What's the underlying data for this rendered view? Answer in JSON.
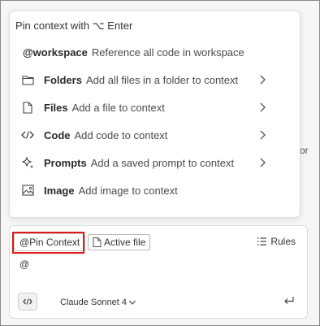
{
  "background": {
    "cut_text": "or"
  },
  "popup": {
    "header": "Pin context with ⌥ Enter",
    "items": [
      {
        "name": "@workspace",
        "desc": "Reference all code in workspace",
        "icon": "none",
        "has_submenu": false
      },
      {
        "name": "Folders",
        "desc": "Add all files in a folder to context",
        "icon": "folder-icon",
        "has_submenu": true
      },
      {
        "name": "Files",
        "desc": "Add a file to context",
        "icon": "file-icon",
        "has_submenu": true
      },
      {
        "name": "Code",
        "desc": "Add code to context",
        "icon": "code-icon",
        "has_submenu": true
      },
      {
        "name": "Prompts",
        "desc": "Add a saved prompt to context",
        "icon": "sparkle-icon",
        "has_submenu": true
      },
      {
        "name": "Image",
        "desc": "Add image to context",
        "icon": "image-icon",
        "has_submenu": false
      }
    ]
  },
  "composer": {
    "pin_label": "@Pin Context",
    "active_file_label": "Active file",
    "rules_label": "Rules",
    "input_text": "@",
    "model_label": "Claude Sonnet 4"
  },
  "colors": {
    "highlight": "#e01818"
  }
}
